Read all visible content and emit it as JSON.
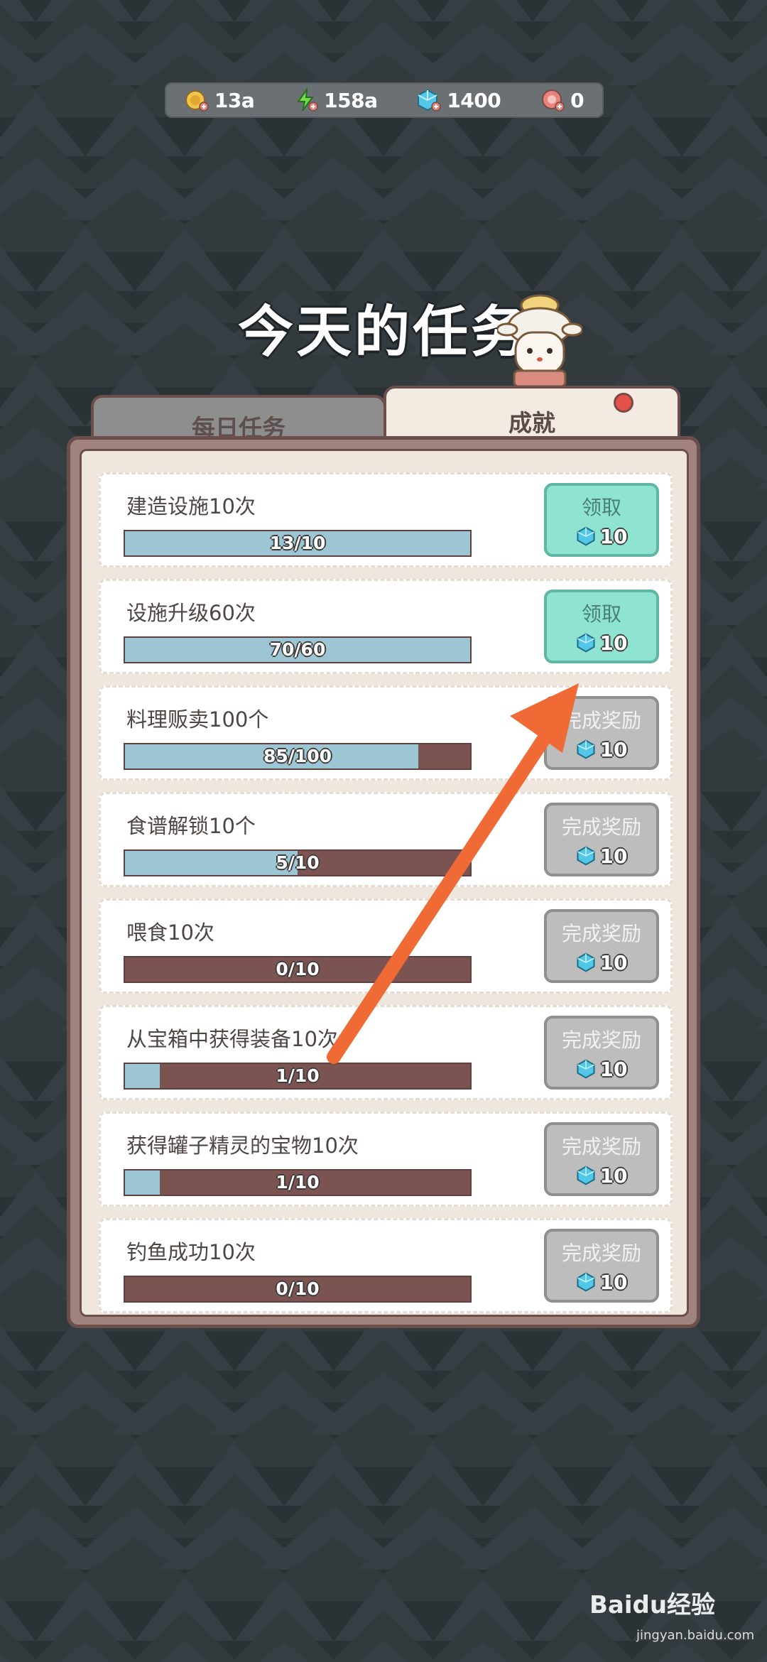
{
  "currency": [
    {
      "icon": "coin-icon",
      "value": "13a",
      "color": "#f2c44a"
    },
    {
      "icon": "lightning-icon",
      "value": "158a",
      "color": "#6fdc4a"
    },
    {
      "icon": "gem-icon",
      "value": "1400",
      "color": "#53c7e8"
    },
    {
      "icon": "meat-icon",
      "value": "0",
      "color": "#e8827a"
    }
  ],
  "title": "今天的任务",
  "tabs": [
    {
      "label": "每日任务",
      "active": false
    },
    {
      "label": "成就",
      "active": true,
      "has_notification": true
    }
  ],
  "tasks": [
    {
      "name": "建造设施10次",
      "progress_text": "13/10",
      "progress": 1.0,
      "button": "领取",
      "claimable": true,
      "reward": "10"
    },
    {
      "name": "设施升级60次",
      "progress_text": "70/60",
      "progress": 1.0,
      "button": "领取",
      "claimable": true,
      "reward": "10"
    },
    {
      "name": "料理贩卖100个",
      "progress_text": "85/100",
      "progress": 0.85,
      "button": "完成奖励",
      "claimable": false,
      "reward": "10"
    },
    {
      "name": "食谱解锁10个",
      "progress_text": "5/10",
      "progress": 0.5,
      "button": "完成奖励",
      "claimable": false,
      "reward": "10"
    },
    {
      "name": "喂食10次",
      "progress_text": "0/10",
      "progress": 0.0,
      "button": "完成奖励",
      "claimable": false,
      "reward": "10"
    },
    {
      "name": "从宝箱中获得装备10次",
      "progress_text": "1/10",
      "progress": 0.1,
      "button": "完成奖励",
      "claimable": false,
      "reward": "10"
    },
    {
      "name": "获得罐子精灵的宝物10次",
      "progress_text": "1/10",
      "progress": 0.1,
      "button": "完成奖励",
      "claimable": false,
      "reward": "10"
    },
    {
      "name": "钓鱼成功10次",
      "progress_text": "0/10",
      "progress": 0.0,
      "button": "完成奖励",
      "claimable": false,
      "reward": "10"
    }
  ],
  "colors": {
    "arrow": "#f06a35",
    "claim": "#8ee4d0",
    "locked": "#bdbdbd"
  },
  "watermark": {
    "logo": "Baidu经验",
    "url": "jingyan.baidu.com"
  }
}
